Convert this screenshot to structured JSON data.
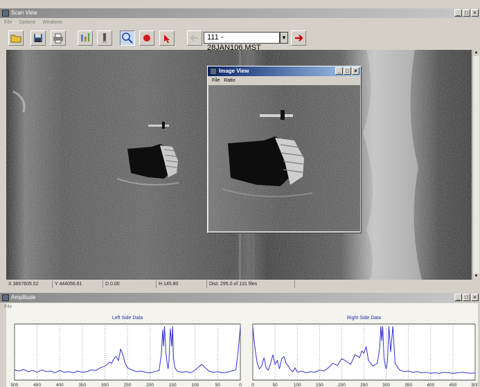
{
  "scan_window": {
    "title": "Scan View",
    "menu": [
      "File",
      "Options",
      "Windows"
    ],
    "file_select": "111 - 28JAN106.MST"
  },
  "toolbar": {
    "buttons": [
      "open-icon",
      "save-icon",
      "print-icon",
      "filter-icon",
      "probe-icon",
      "zoom-icon",
      "record-icon",
      "pointer-icon",
      "prev-file-icon",
      "next-file-icon"
    ],
    "accent": "#cc0000"
  },
  "status": {
    "x": "X 3667605.52",
    "y": "Y 444056.61",
    "d": "D 0.00",
    "h": "H 145.80",
    "dist": "Dist: 295.0 of 131 files"
  },
  "image_window": {
    "title": "Image View",
    "menu": [
      "File",
      "Ratio"
    ]
  },
  "amplitude_window": {
    "title": "Amplitude",
    "menu": [
      "File"
    ]
  },
  "chart_data": [
    {
      "type": "line",
      "title": "Left Side Data",
      "x_ticks": [
        500,
        450,
        400,
        350,
        300,
        250,
        200,
        150,
        100,
        50,
        0
      ],
      "xlim": [
        500,
        0
      ],
      "ylim": [
        0,
        100
      ],
      "grid": true,
      "series": [
        {
          "color": "#3030d0",
          "x": [
            500,
            490,
            480,
            470,
            460,
            450,
            440,
            430,
            420,
            410,
            400,
            390,
            380,
            370,
            360,
            350,
            340,
            330,
            320,
            310,
            300,
            295,
            290,
            285,
            280,
            275,
            270,
            265,
            260,
            255,
            250,
            240,
            230,
            220,
            210,
            200,
            190,
            180,
            175,
            172,
            170,
            168,
            165,
            162,
            160,
            158,
            155,
            152,
            150,
            148,
            145,
            140,
            130,
            120,
            110,
            100,
            90,
            85,
            80,
            75,
            70,
            60,
            50,
            40,
            30,
            20,
            10,
            5,
            0
          ],
          "y": [
            18,
            16,
            19,
            15,
            17,
            14,
            18,
            15,
            16,
            13,
            17,
            14,
            15,
            13,
            16,
            14,
            15,
            18,
            17,
            22,
            25,
            28,
            32,
            30,
            38,
            42,
            35,
            55,
            45,
            30,
            22,
            18,
            15,
            16,
            14,
            13,
            15,
            17,
            45,
            90,
            60,
            96,
            50,
            30,
            20,
            35,
            92,
            60,
            96,
            40,
            22,
            16,
            14,
            15,
            13,
            18,
            25,
            28,
            24,
            20,
            16,
            14,
            15,
            13,
            14,
            16,
            18,
            50,
            95
          ]
        }
      ]
    },
    {
      "type": "line",
      "title": "Right Side Data",
      "x_ticks": [
        0,
        50,
        100,
        150,
        200,
        250,
        300,
        350,
        400,
        450,
        500
      ],
      "xlim": [
        0,
        500
      ],
      "ylim": [
        0,
        100
      ],
      "grid": true,
      "series": [
        {
          "color": "#3030d0",
          "x": [
            0,
            3,
            6,
            10,
            15,
            20,
            25,
            30,
            35,
            40,
            45,
            50,
            55,
            60,
            65,
            70,
            75,
            80,
            85,
            90,
            95,
            100,
            110,
            120,
            130,
            140,
            150,
            160,
            170,
            180,
            190,
            200,
            210,
            220,
            230,
            240,
            245,
            250,
            255,
            260,
            270,
            280,
            285,
            288,
            290,
            292,
            295,
            298,
            300,
            303,
            306,
            310,
            315,
            320,
            330,
            340,
            350,
            360,
            370,
            380,
            390,
            400,
            410,
            420,
            430,
            440,
            450,
            460,
            470,
            480,
            490,
            500
          ],
          "y": [
            95,
            70,
            50,
            30,
            20,
            25,
            40,
            22,
            18,
            30,
            45,
            28,
            35,
            20,
            38,
            42,
            30,
            25,
            18,
            15,
            22,
            14,
            16,
            13,
            15,
            14,
            18,
            16,
            22,
            30,
            26,
            38,
            34,
            28,
            45,
            40,
            52,
            48,
            60,
            35,
            25,
            30,
            55,
            96,
            70,
            96,
            40,
            25,
            20,
            35,
            96,
            50,
            96,
            30,
            18,
            15,
            16,
            14,
            15,
            13,
            14,
            12,
            13,
            12,
            14,
            13,
            12,
            13,
            14,
            13,
            12,
            13
          ]
        }
      ]
    }
  ]
}
